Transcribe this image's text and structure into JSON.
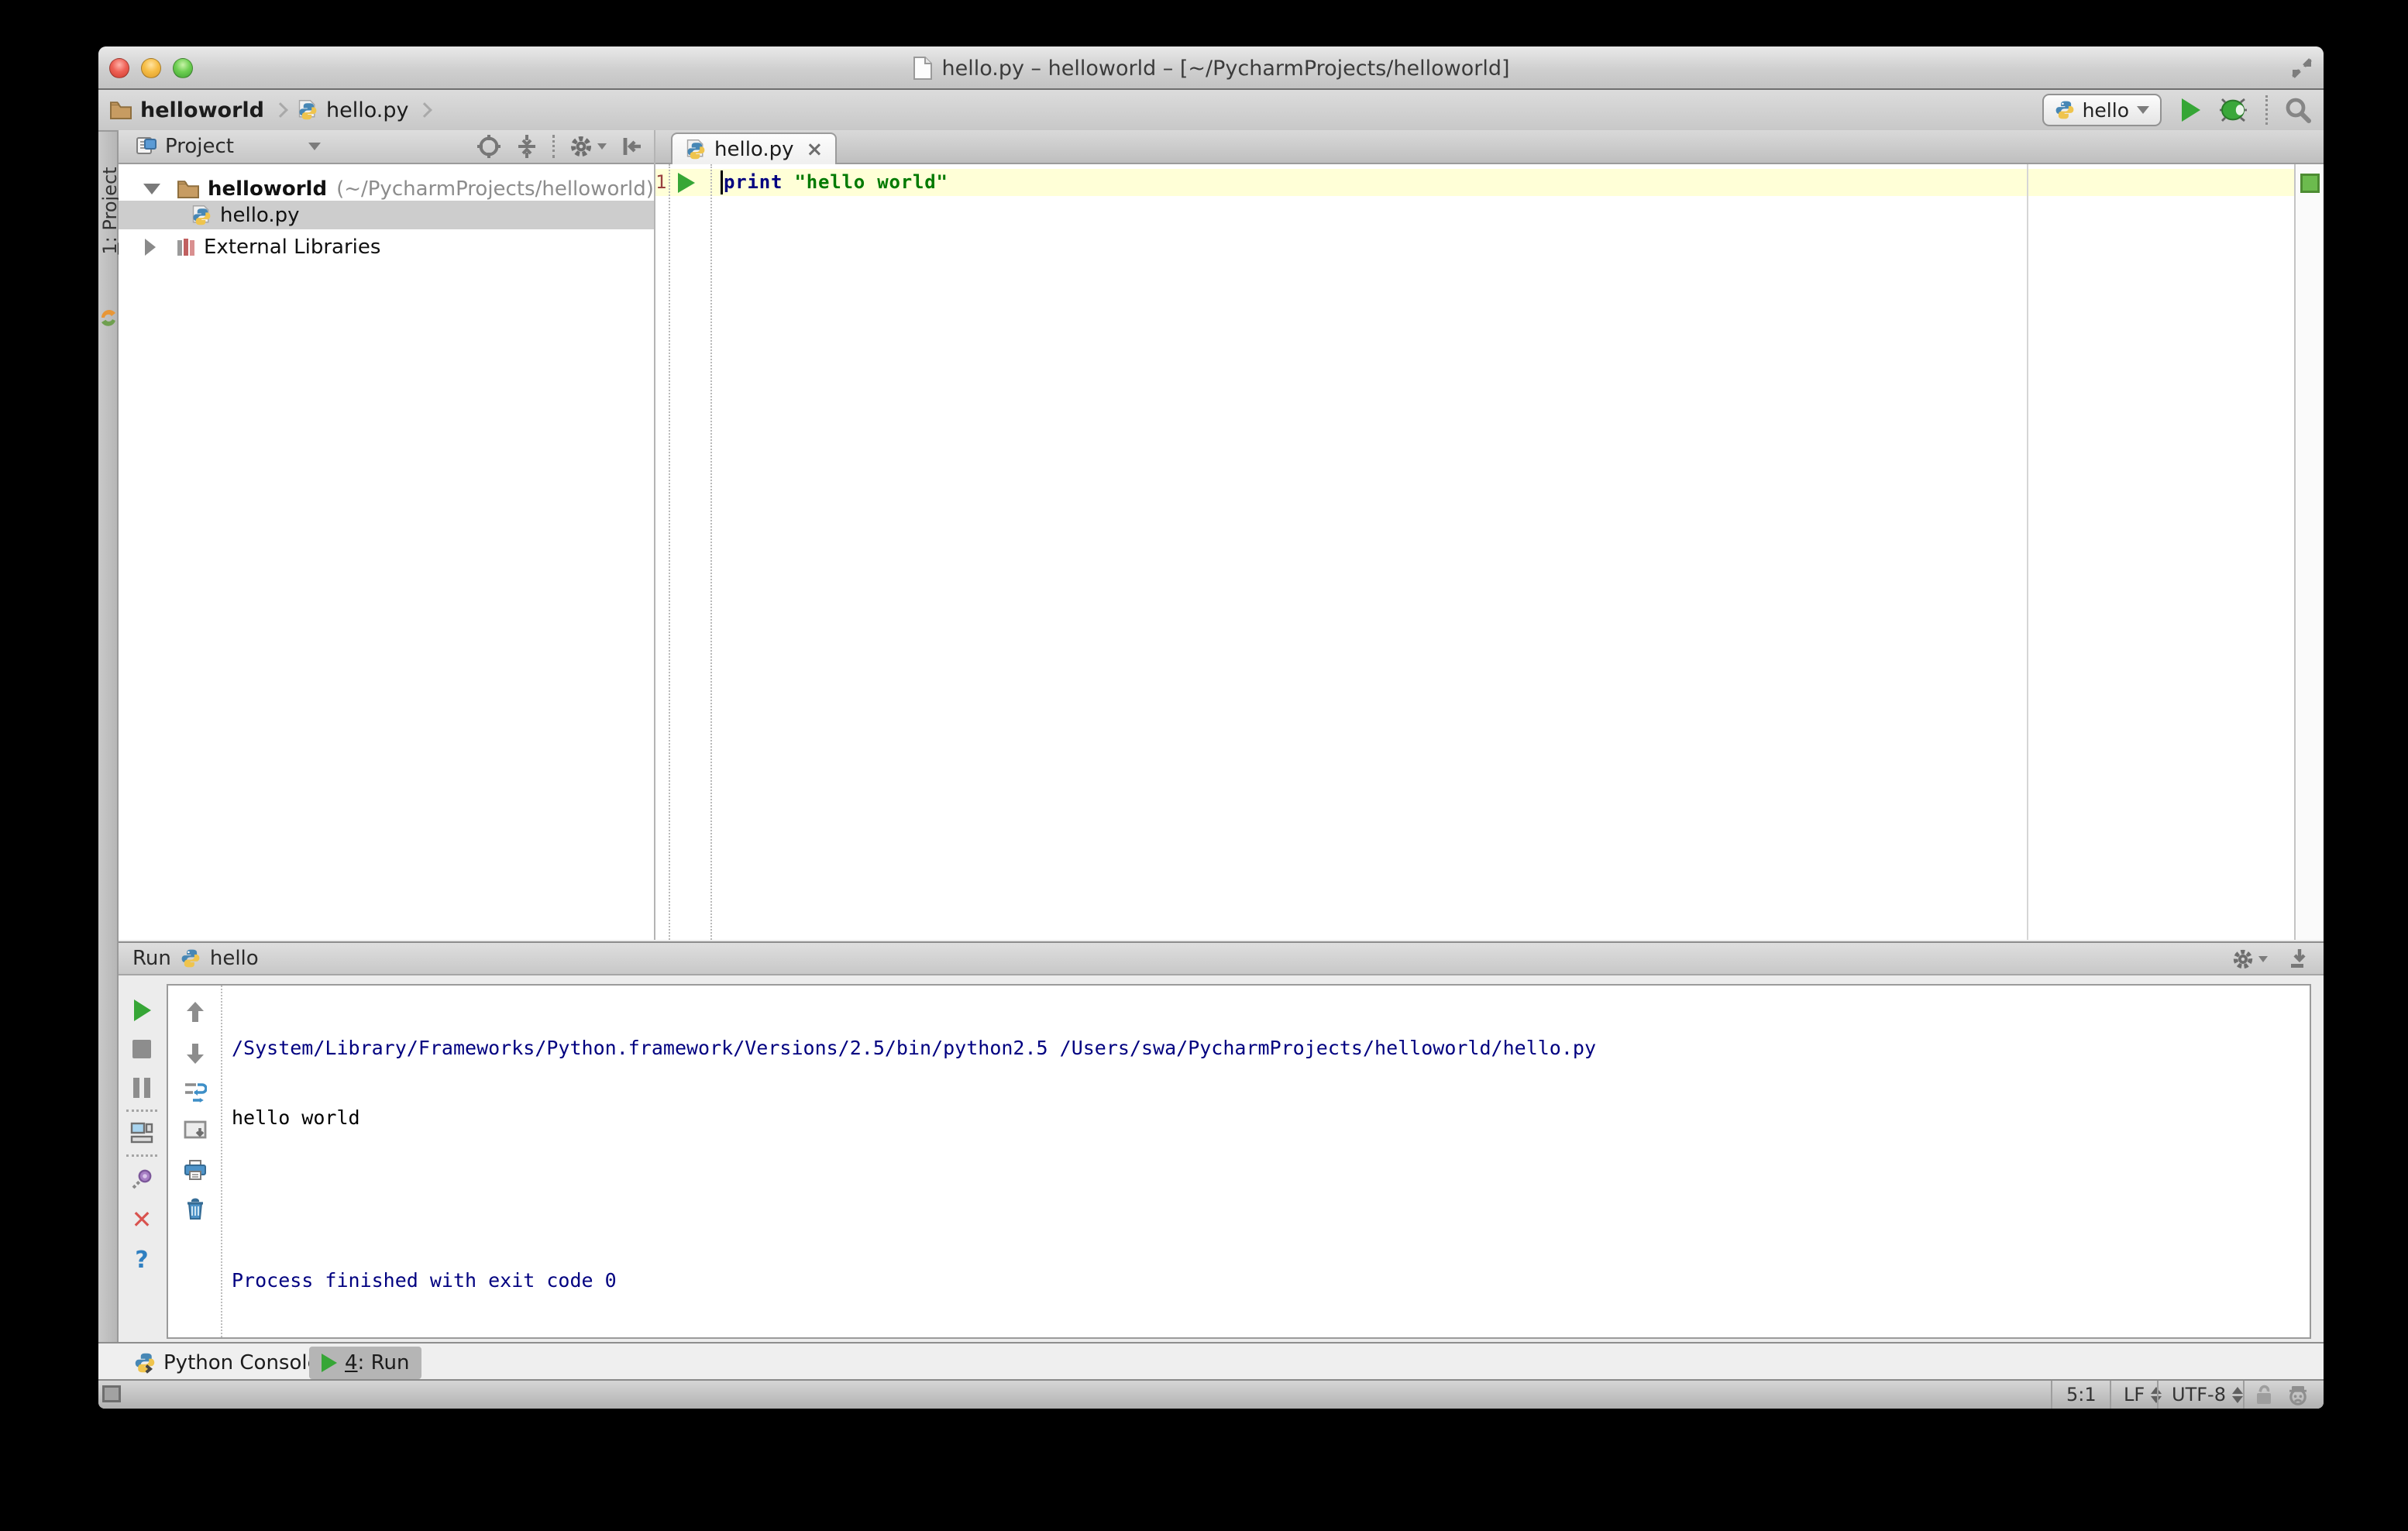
{
  "titlebar": {
    "title": "hello.py – helloworld – [~/PycharmProjects/helloworld]"
  },
  "breadcrumb": {
    "items": [
      "helloworld",
      "hello.py"
    ]
  },
  "toolbar": {
    "run_config": "hello"
  },
  "left_strip": {
    "project_button_number": "1",
    "project_button_label": ": Project"
  },
  "project_panel": {
    "title": "Project",
    "tree": {
      "root_label": "helloworld",
      "root_path": "(~/PycharmProjects/helloworld)",
      "file_label": "hello.py",
      "libraries_label": "External Libraries"
    }
  },
  "editor": {
    "tab_label": "hello.py",
    "close_glyph": "×",
    "line_number": "1",
    "code_keyword": "print",
    "code_string": "\"hello world\""
  },
  "run_panel": {
    "title": "Run",
    "config_name": "hello",
    "help_glyph": "?",
    "close_glyph": "✕",
    "console": {
      "line1": "/System/Library/Frameworks/Python.framework/Versions/2.5/bin/python2.5 /Users/swa/PycharmProjects/helloworld/hello.py",
      "line2": "hello world",
      "line3": "",
      "line4": "Process finished with exit code 0"
    }
  },
  "bottom_bar": {
    "python_console_label": "Python Console",
    "run_tab_number": "4",
    "run_tab_label": ": Run"
  },
  "status_bar": {
    "caret_position": "5:1",
    "line_separator": "LF",
    "encoding": "UTF-8"
  },
  "colors": {
    "keyword": "#000080",
    "string": "#007a00",
    "console_system": "#000080",
    "console_stdout": "#000000",
    "run_green": "#36a636",
    "current_line_bg": "#FFFFD7",
    "annotation_green": "#6cbb4e"
  }
}
